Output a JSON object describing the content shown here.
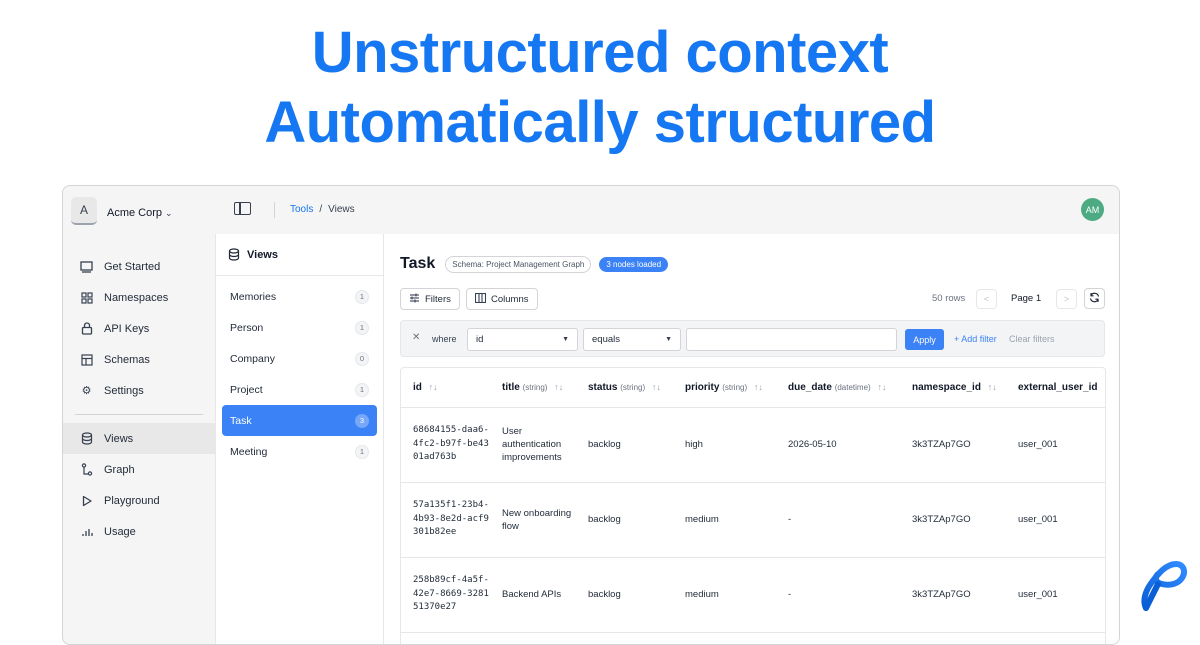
{
  "hero": {
    "line1": "Unstructured context",
    "line2": "Automatically structured",
    "color": "#1677f2"
  },
  "topbar": {
    "org_initial": "A",
    "org_name": "Acme Corp",
    "breadcrumb": [
      "Tools",
      "Views"
    ],
    "breadcrumb_sep": "/",
    "user_initials": "AM"
  },
  "nav": {
    "group1": [
      {
        "label": "Get Started",
        "icon": "monitor-icon"
      },
      {
        "label": "Namespaces",
        "icon": "grid-icon"
      },
      {
        "label": "API Keys",
        "icon": "lock-icon"
      },
      {
        "label": "Schemas",
        "icon": "table-icon"
      },
      {
        "label": "Settings",
        "icon": "gear-icon"
      }
    ],
    "group2": [
      {
        "label": "Views",
        "icon": "database-icon",
        "active": true
      },
      {
        "label": "Graph",
        "icon": "graph-icon"
      },
      {
        "label": "Playground",
        "icon": "play-icon"
      },
      {
        "label": "Usage",
        "icon": "bar-chart-icon"
      }
    ]
  },
  "views_panel": {
    "title": "Views",
    "items": [
      {
        "label": "Memories",
        "count": "1"
      },
      {
        "label": "Person",
        "count": "1"
      },
      {
        "label": "Company",
        "count": "0"
      },
      {
        "label": "Project",
        "count": "1"
      },
      {
        "label": "Task",
        "count": "3",
        "active": true
      },
      {
        "label": "Meeting",
        "count": "1"
      }
    ]
  },
  "main": {
    "title": "Task",
    "schema_pill": "Schema: Project Management Graph",
    "nodes_pill": "3 nodes loaded",
    "filters_label": "Filters",
    "columns_label": "Columns",
    "rows_info": "50 rows",
    "page_label": "Page 1",
    "prev": "<",
    "next": ">"
  },
  "filter": {
    "where": "where",
    "field": "id",
    "operator": "equals",
    "value": "",
    "apply": "Apply",
    "add_filter": "+ Add filter",
    "clear_filters": "Clear filters"
  },
  "table": {
    "columns": [
      {
        "name": "id",
        "type": ""
      },
      {
        "name": "title",
        "type": "(string)"
      },
      {
        "name": "status",
        "type": "(string)"
      },
      {
        "name": "priority",
        "type": "(string)"
      },
      {
        "name": "due_date",
        "type": "(datetime)"
      },
      {
        "name": "namespace_id",
        "type": ""
      },
      {
        "name": "external_user_id",
        "type": ""
      }
    ],
    "sort_glyph": "↑↓",
    "rows": [
      {
        "id": "68684155-daa6-4fc2-b97f-be4301ad763b",
        "title": "User authentication improvements",
        "status": "backlog",
        "priority": "high",
        "due_date": "2026-05-10",
        "namespace_id": "3k3TZAp7GO",
        "external_user_id": "user_001"
      },
      {
        "id": "57a135f1-23b4-4b93-8e2d-acf9301b82ee",
        "title": "New onboarding flow",
        "status": "backlog",
        "priority": "medium",
        "due_date": "-",
        "namespace_id": "3k3TZAp7GO",
        "external_user_id": "user_001"
      },
      {
        "id": "258b89cf-4a5f-42e7-8669-328151370e27",
        "title": "Backend APIs",
        "status": "backlog",
        "priority": "medium",
        "due_date": "-",
        "namespace_id": "3k3TZAp7GO",
        "external_user_id": "user_001"
      }
    ]
  }
}
